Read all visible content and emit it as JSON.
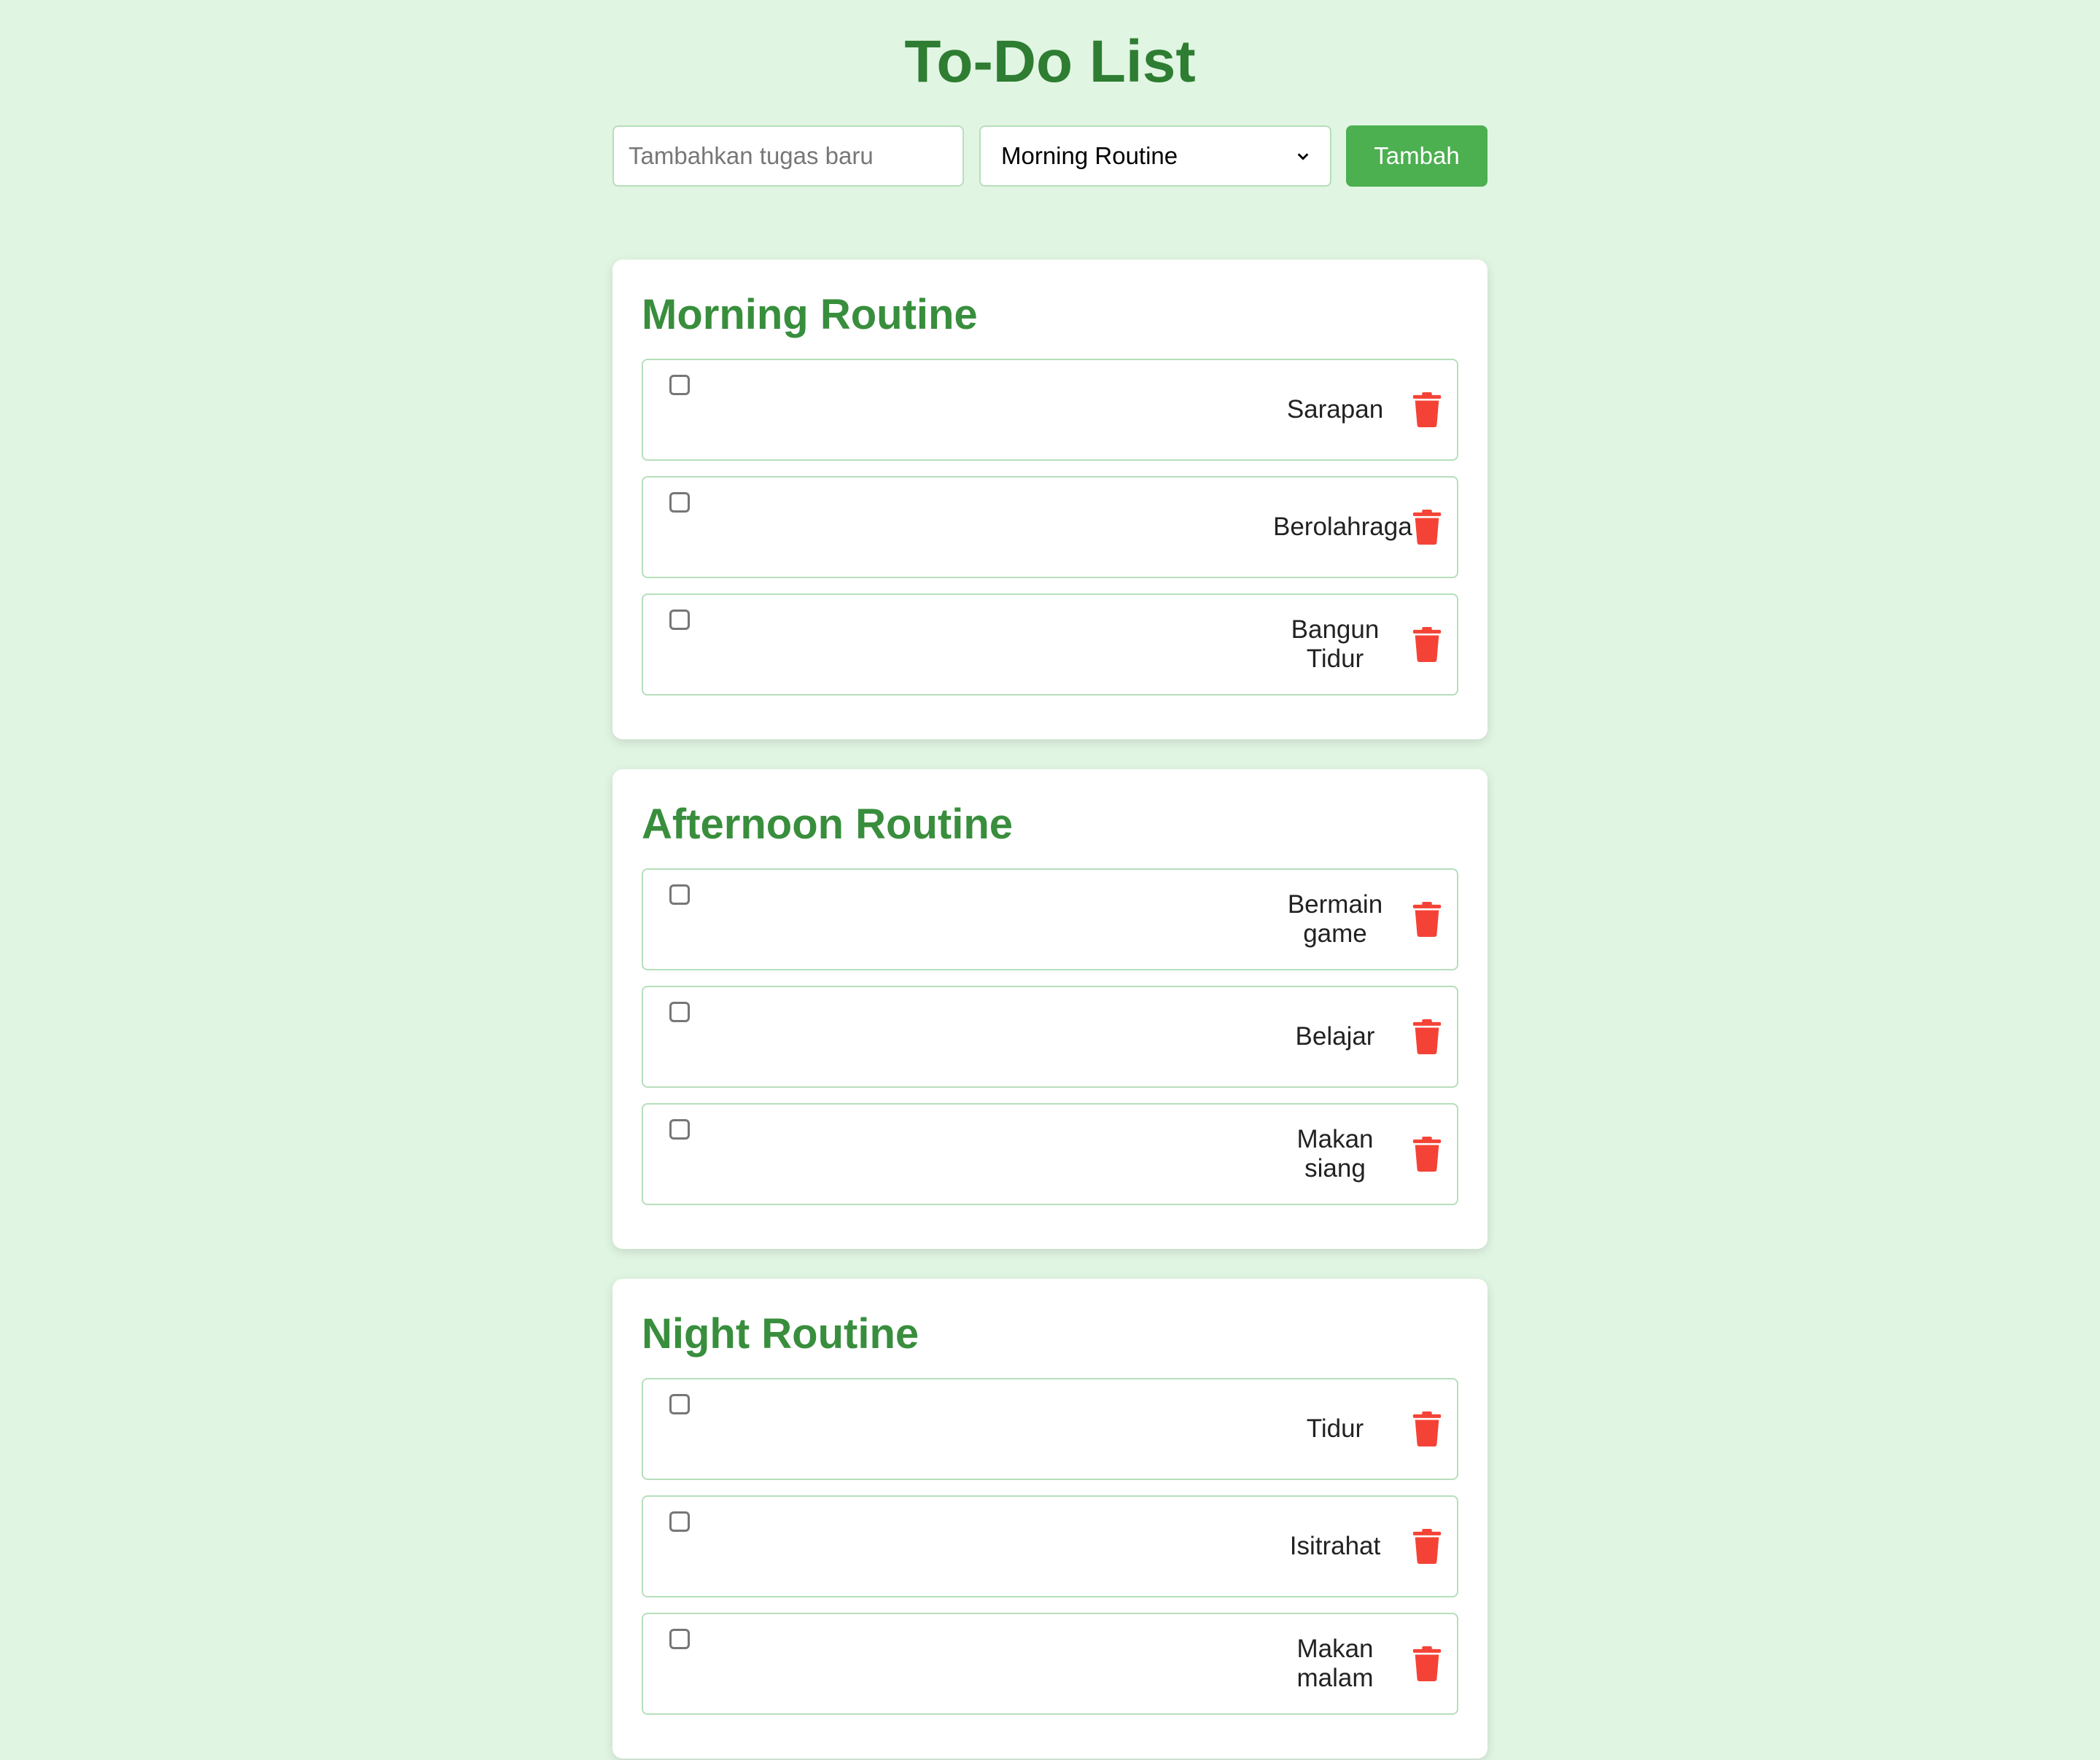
{
  "title": "To-Do List",
  "form": {
    "input_placeholder": "Tambahkan tugas baru",
    "input_value": "",
    "selected_routine": "Morning Routine",
    "add_label": "Tambah"
  },
  "colors": {
    "background": "#e1f5e3",
    "title": "#2e7d32",
    "heading": "#388e3c",
    "button": "#4caf50",
    "delete": "#f44336"
  },
  "routines": [
    {
      "name": "Morning Routine",
      "tasks": [
        {
          "text": "Sarapan",
          "done": false,
          "icon": "trash-icon"
        },
        {
          "text": "Berolahraga",
          "done": false,
          "icon": "trash-icon"
        },
        {
          "text": "Bangun Tidur",
          "done": false,
          "icon": "trash-icon"
        }
      ]
    },
    {
      "name": "Afternoon Routine",
      "tasks": [
        {
          "text": "Bermain game",
          "done": false,
          "icon": "trash-icon"
        },
        {
          "text": "Belajar",
          "done": false,
          "icon": "trash-icon"
        },
        {
          "text": "Makan siang",
          "done": false,
          "icon": "trash-icon"
        }
      ]
    },
    {
      "name": "Night Routine",
      "tasks": [
        {
          "text": "Tidur",
          "done": false,
          "icon": "trash-icon"
        },
        {
          "text": "Isitrahat",
          "done": false,
          "icon": "trash-icon"
        },
        {
          "text": "Makan malam",
          "done": false,
          "icon": "trash-icon"
        }
      ]
    }
  ]
}
